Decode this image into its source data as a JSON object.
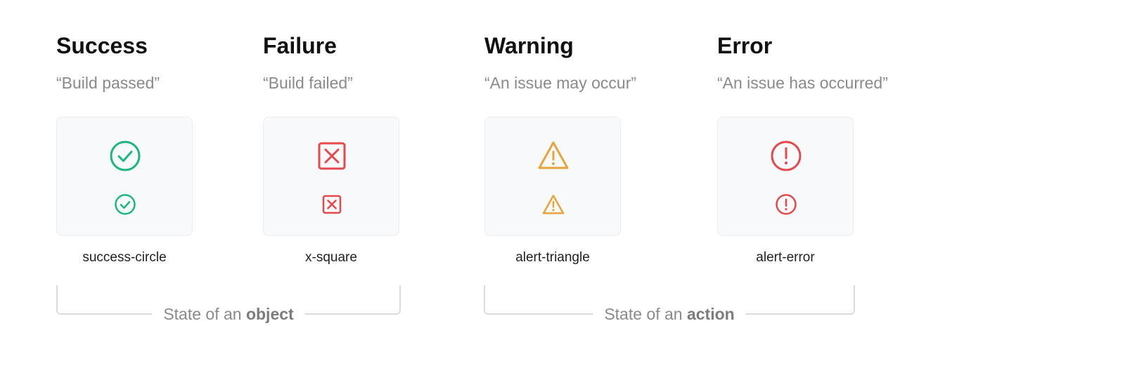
{
  "colors": {
    "success": "#1cb77f",
    "failure": "#e5484d",
    "warning": "#e8a33b",
    "error": "#e5484d"
  },
  "states": [
    {
      "title": "Success",
      "example": "“Build passed”",
      "icon_name": "success-circle",
      "icon": "check-circle-icon"
    },
    {
      "title": "Failure",
      "example": "“Build failed”",
      "icon_name": "x-square",
      "icon": "x-square-icon"
    },
    {
      "title": "Warning",
      "example": "“An issue may occur”",
      "icon_name": "alert-triangle",
      "icon": "alert-triangle-icon"
    },
    {
      "title": "Error",
      "example": "“An issue has occurred”",
      "icon_name": "alert-error",
      "icon": "alert-circle-icon"
    }
  ],
  "groups": [
    {
      "prefix": "State of an ",
      "emphasis": "object"
    },
    {
      "prefix": "State of an ",
      "emphasis": "action"
    }
  ]
}
